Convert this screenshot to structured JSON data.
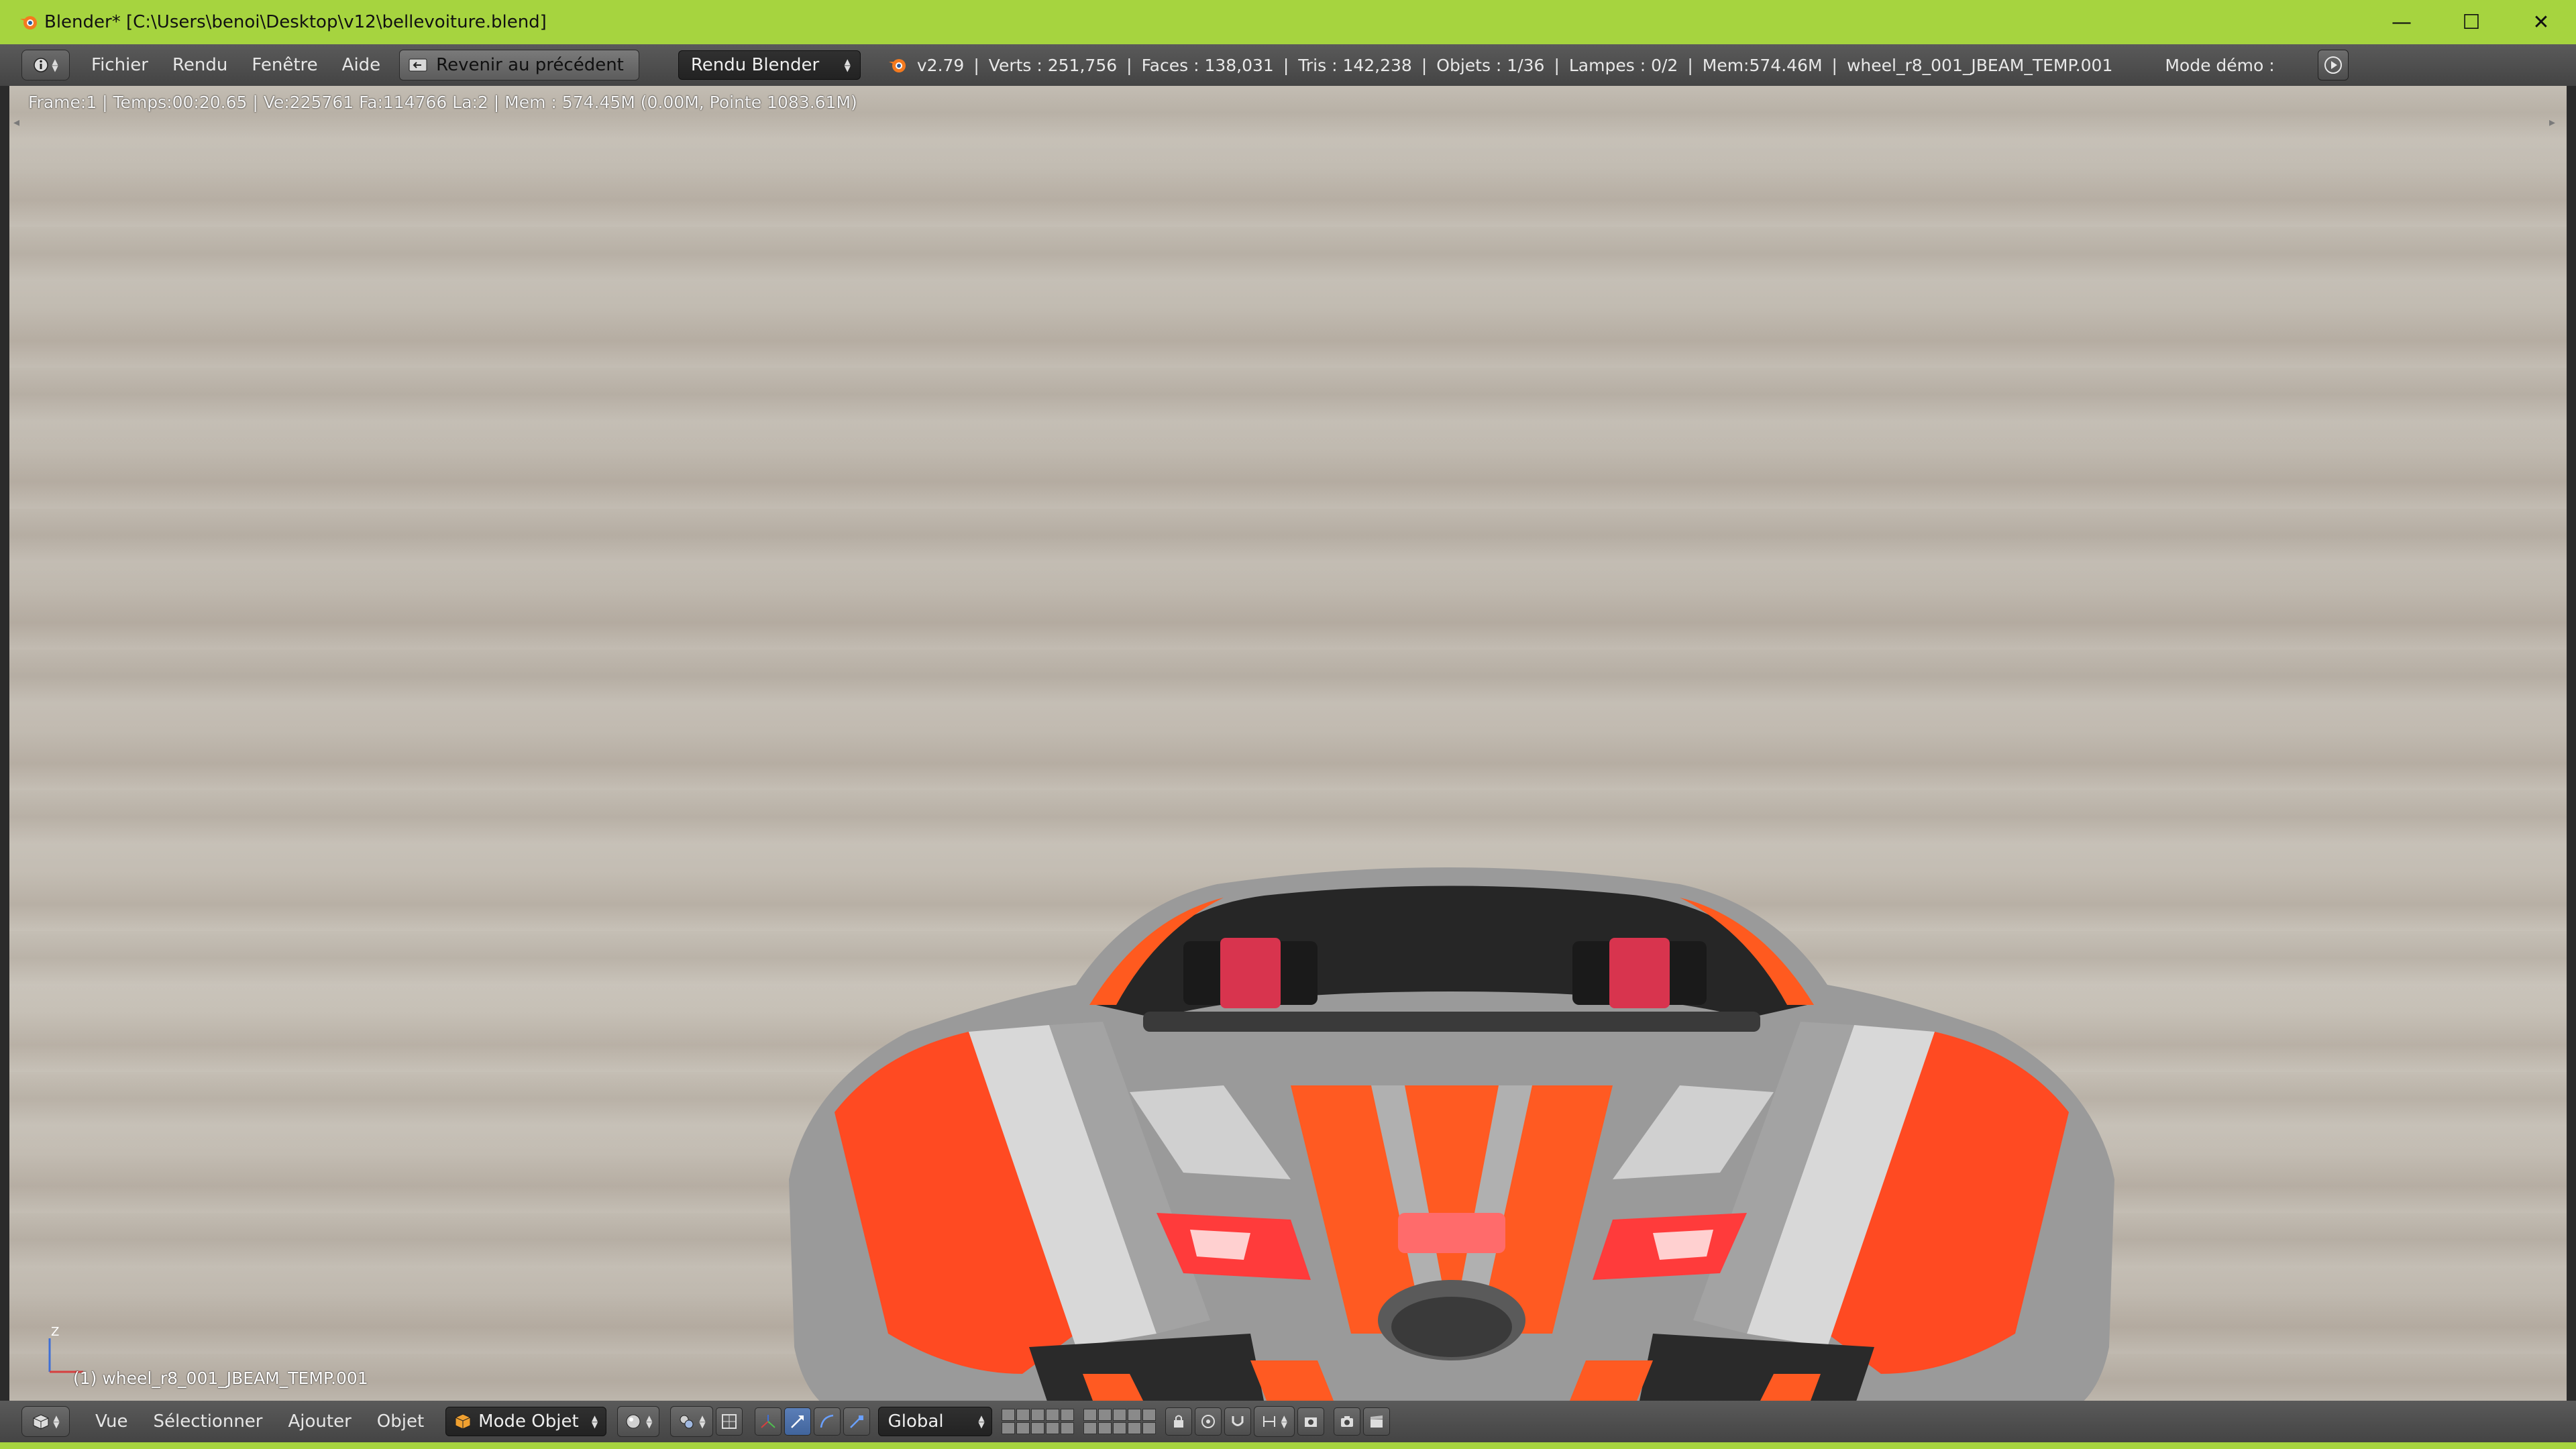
{
  "window": {
    "title": "Blender* [C:\\Users\\benoi\\Desktop\\v12\\bellevoiture.blend]",
    "controls": {
      "minimize": "—",
      "maximize": "☐",
      "close": "✕"
    }
  },
  "info_header": {
    "menus": [
      "Fichier",
      "Rendu",
      "Fenêtre",
      "Aide"
    ],
    "revert_label": "Revenir au précédent",
    "render_engine": "Rendu Blender",
    "stats": {
      "version": "v2.79",
      "verts": "Verts   : 251,756",
      "faces": "Faces   : 138,031",
      "tris": "Tris   : 142,238",
      "objects": "Objets   : 1/36",
      "lamps": "Lampes   : 0/2",
      "mem": "Mem:574.46M",
      "active": "wheel_r8_001_JBEAM_TEMP.001"
    },
    "mode_demo": "Mode démo   :"
  },
  "viewport": {
    "render_info": "Frame:1 | Temps:00:20.65 | Ve:225761 Fa:114766 La:2 | Mem   : 574.45M (0.00M, Pointe 1083.61M)",
    "object_label": "(1) wheel_r8_001_JBEAM_TEMP.001",
    "axis_z": "Z"
  },
  "bottom_header": {
    "menus": [
      "Vue",
      "Sélectionner",
      "Ajouter",
      "Objet"
    ],
    "mode": "Mode Objet",
    "orientation": "Global"
  },
  "colors": {
    "title_bar": "#a6d43f",
    "accent_orange": "#ff5a1f",
    "body_grey": "#9a9a9a"
  }
}
